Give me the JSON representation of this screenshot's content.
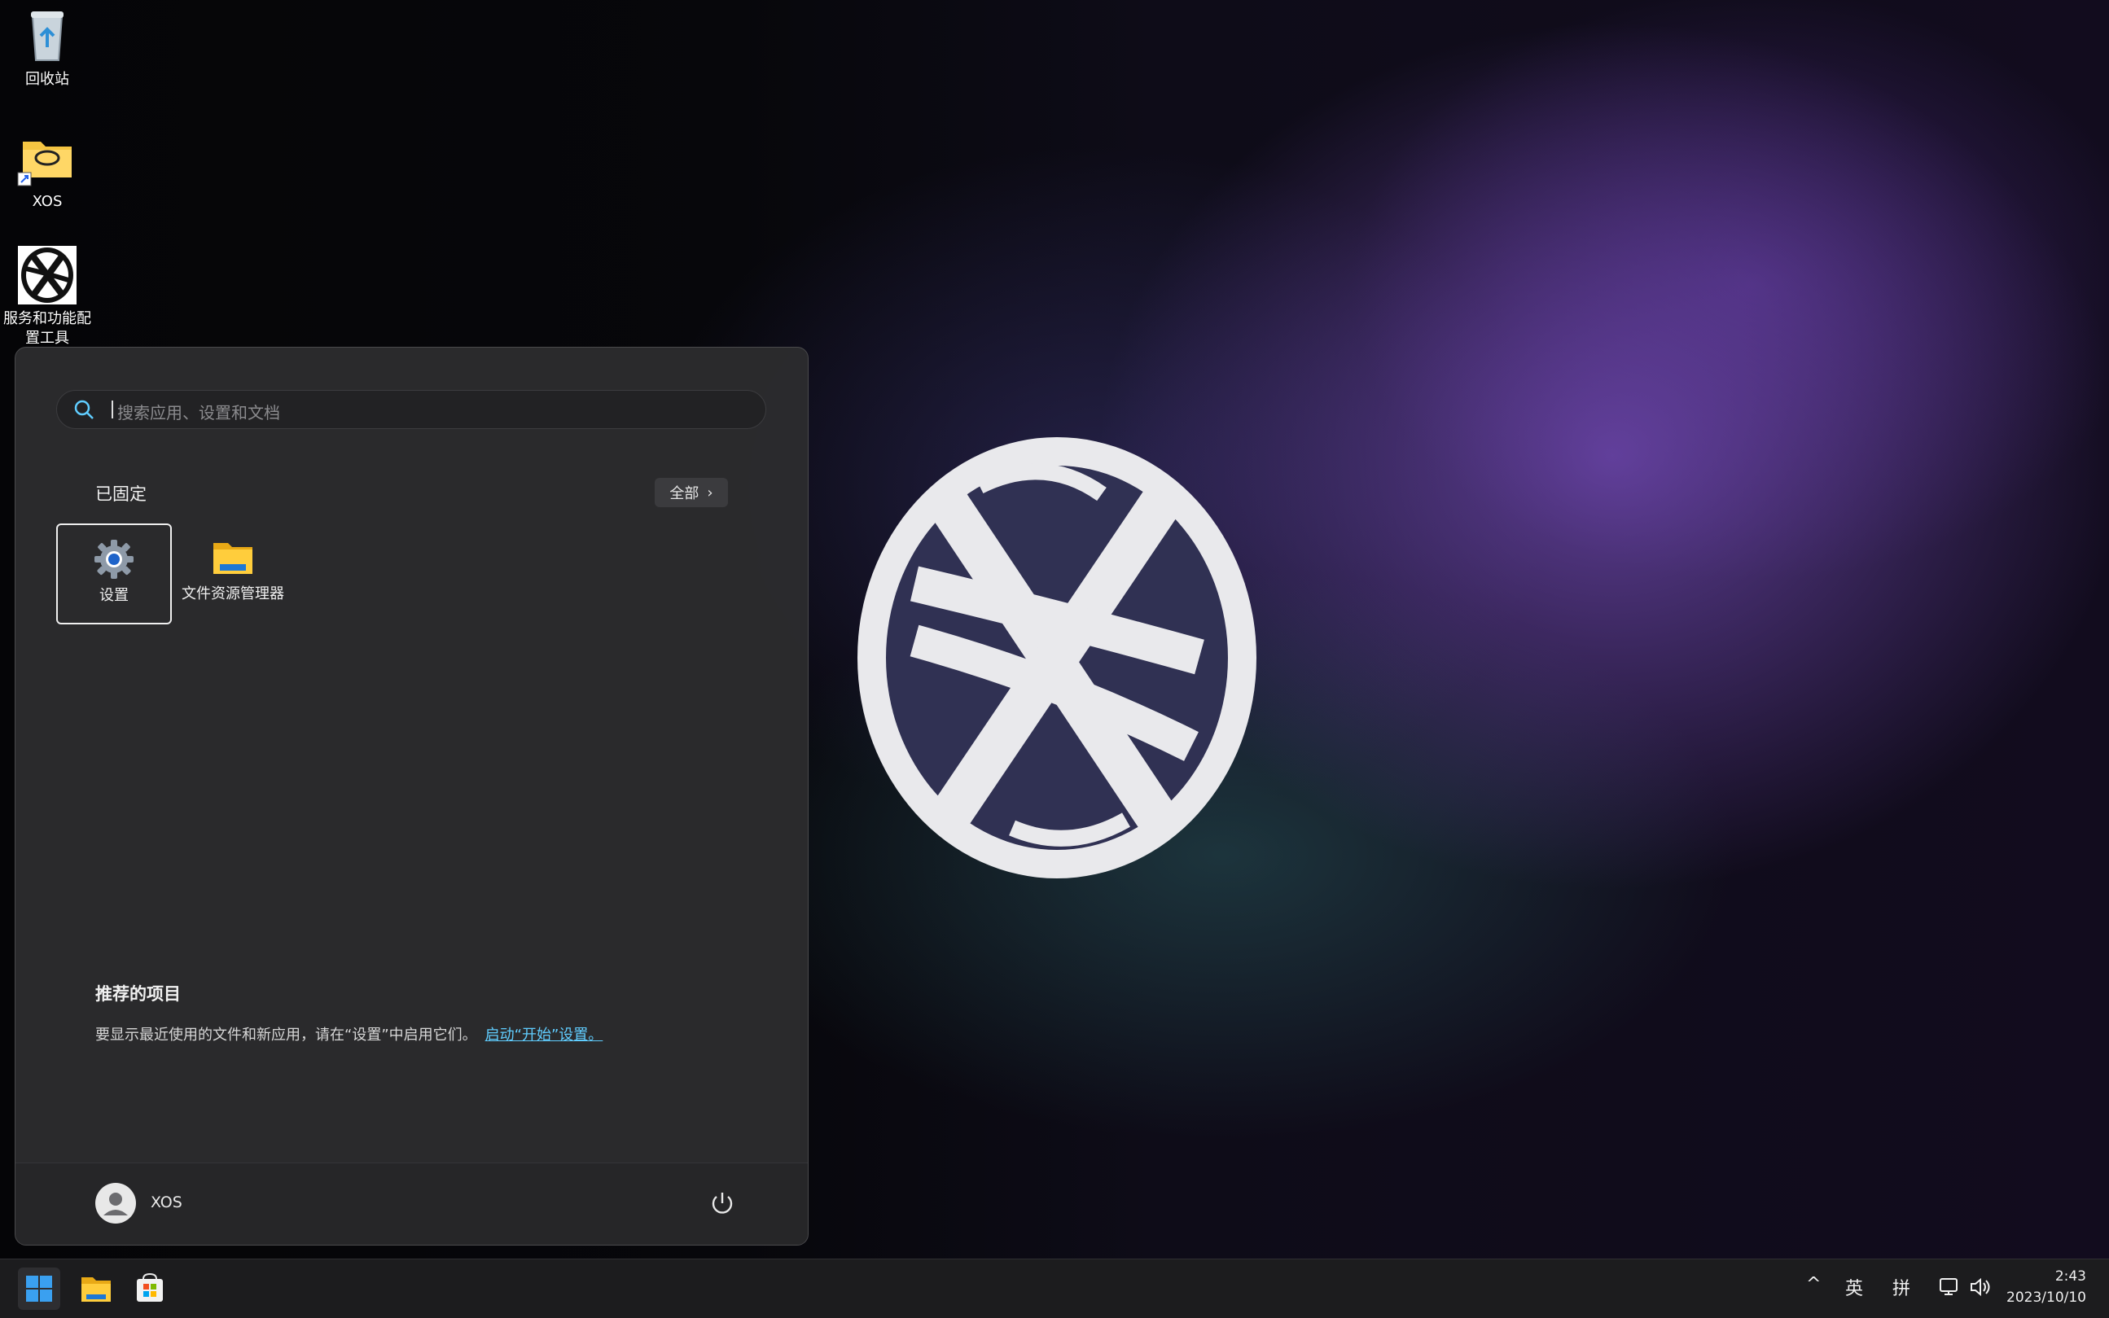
{
  "desktop": {
    "icons": [
      {
        "label": "回收站",
        "icon": "recycle-bin-icon"
      },
      {
        "label": "XOS",
        "icon": "folder-shortcut-icon"
      },
      {
        "label": "服务和功能配置工具",
        "icon": "xos-logo-icon"
      }
    ]
  },
  "start_menu": {
    "search": {
      "placeholder": "搜索应用、设置和文档",
      "icon": "search-icon"
    },
    "pinned": {
      "title": "已固定",
      "all_button": "全部",
      "apps": [
        {
          "label": "设置",
          "icon": "settings-gear-icon",
          "selected": true
        },
        {
          "label": "文件资源管理器",
          "icon": "file-explorer-icon",
          "selected": false
        }
      ]
    },
    "recommended": {
      "title": "推荐的项目",
      "text": "要显示最近使用的文件和新应用，请在“设置”中启用它们。",
      "link": "启动“开始”设置。"
    },
    "user": {
      "name": "XOS"
    },
    "power_icon": "power-icon"
  },
  "taskbar": {
    "pinned": [
      "start-icon",
      "file-explorer-icon",
      "store-icon"
    ],
    "tray": {
      "chevron": "^",
      "ime_mode": "英",
      "ime_layout": "拼",
      "network_icon": "network-icon",
      "volume_icon": "volume-icon"
    },
    "clock": {
      "time": "2:43",
      "date": "2023/10/10"
    }
  },
  "colors": {
    "accent": "#60cdff",
    "menu_bg": "#2c2c2e",
    "taskbar_bg": "#1c1c1e",
    "folder_yellow": "#f5c542"
  }
}
